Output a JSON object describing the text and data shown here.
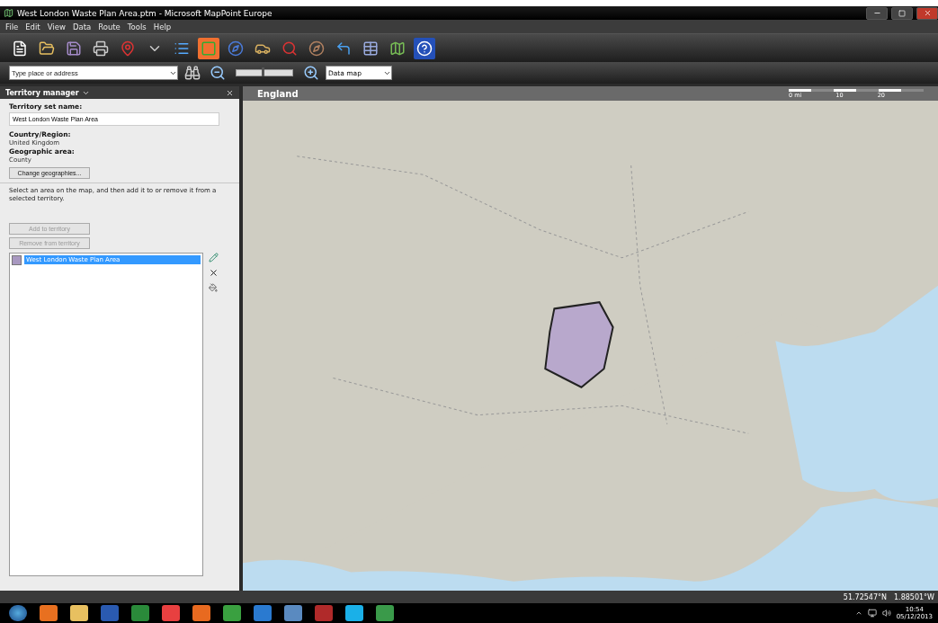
{
  "window": {
    "title": "West London Waste Plan Area.ptm - Microsoft MapPoint Europe"
  },
  "menu": [
    {
      "label": "File"
    },
    {
      "label": "Edit"
    },
    {
      "label": "View"
    },
    {
      "label": "Data"
    },
    {
      "label": "Route"
    },
    {
      "label": "Tools"
    },
    {
      "label": "Help"
    }
  ],
  "find_bar": {
    "placeholder": "Type place or address",
    "zoom_slider": {
      "level": 0.45
    },
    "map_style": "Data map"
  },
  "territory_manager": {
    "title": "Territory manager",
    "set_name_label": "Territory set name:",
    "set_name": "West London Waste Plan Area",
    "country_label": "Country/Region:",
    "country": "United Kingdom",
    "area_label": "Geographic area:",
    "area": "County",
    "change_button": "Change geographies...",
    "instructions": "Select an area on the map, and then add it to or remove it from a selected territory.",
    "add_button": {
      "label": "Add to territory",
      "disabled": true
    },
    "remove_button": {
      "label": "Remove from territory",
      "disabled": true
    },
    "territories": [
      {
        "name": "West London Waste Plan Area",
        "color": "#a898c0",
        "selected": true
      }
    ]
  },
  "map": {
    "title": "England",
    "scale_labels": [
      "0 mi",
      "10",
      "20"
    ]
  },
  "status_bar": {
    "latitude": "51.72547°N",
    "longitude": "1.88501°W"
  },
  "taskbar": {
    "time": "10:54",
    "date": "05/12/2013"
  }
}
